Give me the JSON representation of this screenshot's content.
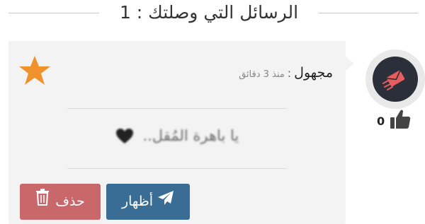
{
  "header": {
    "title": "الرسائل التي وصلتك : 1"
  },
  "message": {
    "sender": "مجهول",
    "separator": ":",
    "time": "منذ 3 دقائق",
    "text": "يا باهرة المُقل..",
    "likes": "0"
  },
  "actions": {
    "show_label": "أظهار",
    "delete_label": "حذف"
  },
  "colors": {
    "show_button": "#3a6d96",
    "delete_button": "#c8686a",
    "star": "#f0922b",
    "avatar_bg": "#2b2f3a",
    "avatar_icon": "#e85d5d"
  },
  "icons": {
    "avatar": "flying-envelope-icon",
    "star": "star-icon",
    "likes": "thumbs-up-icon",
    "show": "paper-plane-icon",
    "delete": "trash-icon",
    "heart": "heart-icon"
  }
}
